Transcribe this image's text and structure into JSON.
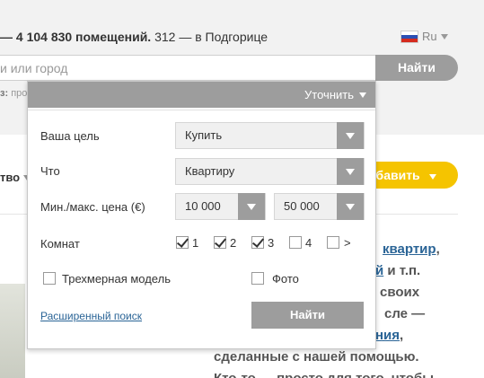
{
  "header": {
    "stats_bold": "— 4 104 830 помещений.",
    "stats_rest": "312 — в Подгорице",
    "language": "Ru"
  },
  "search": {
    "placeholder": "и или город",
    "button": "Найти",
    "hint_bold": "з:",
    "hint_rest": "про"
  },
  "toolbar": {
    "sort_label": "тво",
    "add_button": "обавить"
  },
  "promo": {
    "lines": [
      {
        "pre": "",
        "link": "квартир",
        "post": ","
      },
      {
        "pre": "",
        "link": "й",
        "post": " и т.п."
      },
      {
        "pre": "своих",
        "link": "",
        "post": ""
      },
      {
        "pre": "сле —",
        "link": "",
        "post": ""
      },
      {
        "pre": "",
        "link": "ния",
        "post": ","
      },
      {
        "pre": "сделанные с нашей помощью.",
        "link": "",
        "post": ""
      },
      {
        "pre": "Кто-то — просто для того, чтобы",
        "link": "",
        "post": ""
      }
    ]
  },
  "filter": {
    "header": "Уточнить",
    "goal_label": "Ваша цель",
    "goal_value": "Купить",
    "what_label": "Что",
    "what_value": "Квартиру",
    "price_label": "Мин./макс. цена (€)",
    "price_min": "10 000",
    "price_max": "50 000",
    "rooms_label": "Комнат",
    "rooms": [
      {
        "label": "1",
        "checked": true
      },
      {
        "label": "2",
        "checked": true
      },
      {
        "label": "3",
        "checked": true
      },
      {
        "label": "4",
        "checked": false
      },
      {
        "label": ">",
        "checked": false
      }
    ],
    "model3d_label": "Трехмерная модель",
    "model3d_checked": false,
    "photo_label": "Фото",
    "photo_checked": false,
    "advanced_link": "Расширенный поиск",
    "find_button": "Найти"
  },
  "colors": {
    "panel_header": "#9d9d9d",
    "link": "#2a6496",
    "accent_yellow": "#f5c400"
  }
}
